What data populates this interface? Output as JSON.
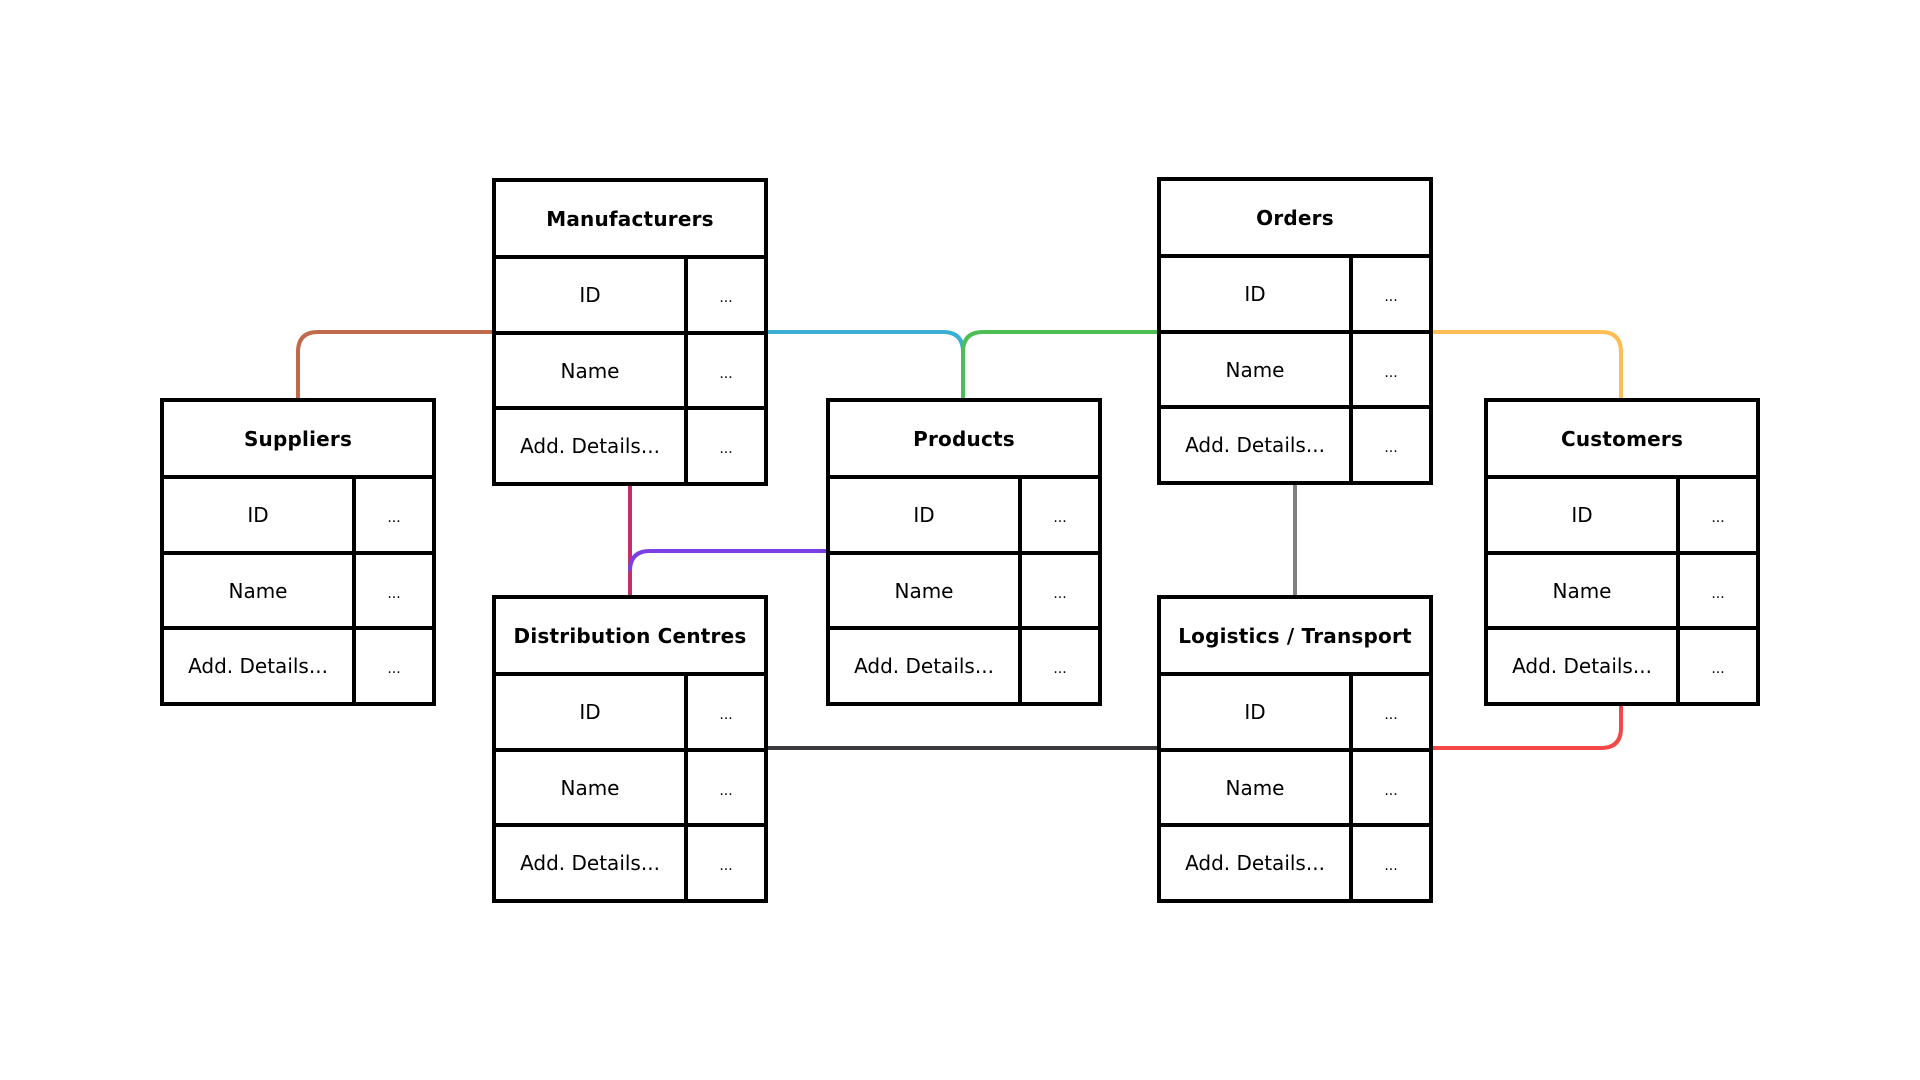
{
  "diagram": {
    "type": "entity-relationship",
    "entities": [
      {
        "id": "suppliers",
        "title": "Suppliers",
        "fields": [
          {
            "name": "ID",
            "value": "..."
          },
          {
            "name": "Name",
            "value": "..."
          },
          {
            "name": "Add. Details...",
            "value": "..."
          }
        ]
      },
      {
        "id": "manufacturers",
        "title": "Manufacturers",
        "fields": [
          {
            "name": "ID",
            "value": "..."
          },
          {
            "name": "Name",
            "value": "..."
          },
          {
            "name": "Add. Details...",
            "value": "..."
          }
        ]
      },
      {
        "id": "distribution",
        "title": "Distribution Centres",
        "fields": [
          {
            "name": "ID",
            "value": "..."
          },
          {
            "name": "Name",
            "value": "..."
          },
          {
            "name": "Add. Details...",
            "value": "..."
          }
        ]
      },
      {
        "id": "products",
        "title": "Products",
        "fields": [
          {
            "name": "ID",
            "value": "..."
          },
          {
            "name": "Name",
            "value": "..."
          },
          {
            "name": "Add. Details...",
            "value": "..."
          }
        ]
      },
      {
        "id": "orders",
        "title": "Orders",
        "fields": [
          {
            "name": "ID",
            "value": "..."
          },
          {
            "name": "Name",
            "value": "..."
          },
          {
            "name": "Add. Details...",
            "value": "..."
          }
        ]
      },
      {
        "id": "logistics",
        "title": "Logistics / Transport",
        "fields": [
          {
            "name": "ID",
            "value": "..."
          },
          {
            "name": "Name",
            "value": "..."
          },
          {
            "name": "Add. Details...",
            "value": "..."
          }
        ]
      },
      {
        "id": "customers",
        "title": "Customers",
        "fields": [
          {
            "name": "ID",
            "value": "..."
          },
          {
            "name": "Name",
            "value": "..."
          },
          {
            "name": "Add. Details...",
            "value": "..."
          }
        ]
      }
    ],
    "relationships": [
      {
        "id": "manufacturers-suppliers",
        "from": "Manufacturers",
        "to": "Suppliers",
        "color": "#c0694b"
      },
      {
        "id": "manufacturers-products",
        "from": "Manufacturers",
        "to": "Products",
        "color": "#3aaed3"
      },
      {
        "id": "orders-products",
        "from": "Orders",
        "to": "Products",
        "color": "#4cbe55"
      },
      {
        "id": "orders-customers",
        "from": "Orders",
        "to": "Customers",
        "color": "#ffbe55"
      },
      {
        "id": "manufacturers-distribution",
        "from": "Manufacturers",
        "to": "Distribution Centres",
        "color": "#c2306a"
      },
      {
        "id": "products-distribution",
        "from": "Products",
        "to": "Distribution Centres",
        "color": "#7b3fe4"
      },
      {
        "id": "orders-logistics",
        "from": "Orders",
        "to": "Logistics / Transport",
        "color": "#808080"
      },
      {
        "id": "distribution-logistics",
        "from": "Distribution Centres",
        "to": "Logistics / Transport",
        "color": "#3a3a3e"
      },
      {
        "id": "logistics-customers",
        "from": "Logistics / Transport",
        "to": "Customers",
        "color": "#f24848"
      }
    ]
  }
}
